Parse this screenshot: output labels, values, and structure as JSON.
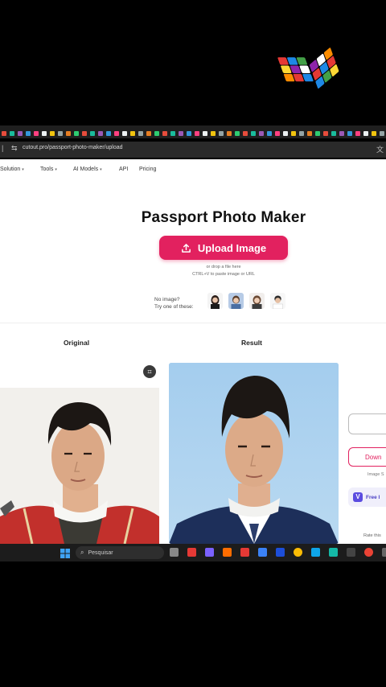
{
  "browser": {
    "url": "cutout.pro/passport-photo-maker/upload"
  },
  "nav": {
    "items": [
      {
        "label": "Solution",
        "has_menu": true
      },
      {
        "label": "Tools",
        "has_menu": true
      },
      {
        "label": "AI Models",
        "has_menu": true
      },
      {
        "label": "API",
        "has_menu": false
      },
      {
        "label": "Pricing",
        "has_menu": false
      }
    ]
  },
  "hero": {
    "title": "Passport Photo Maker",
    "upload_label": "Upload Image",
    "drop_hint": "or drop a file here",
    "paste_hint": "CTRL+V to paste image or URL",
    "no_image_line1": "No image?",
    "no_image_line2": "Try one of these:"
  },
  "compare": {
    "original_label": "Original",
    "result_label": "Result"
  },
  "side": {
    "download_label": "Down",
    "image_size_label": "Image S",
    "free_label": "Free I",
    "rate_label": "Rate this"
  },
  "taskbar": {
    "search_placeholder": "Pesquisar"
  },
  "colors": {
    "accent": "#e2215f",
    "result_bg": "#a9cfee"
  }
}
